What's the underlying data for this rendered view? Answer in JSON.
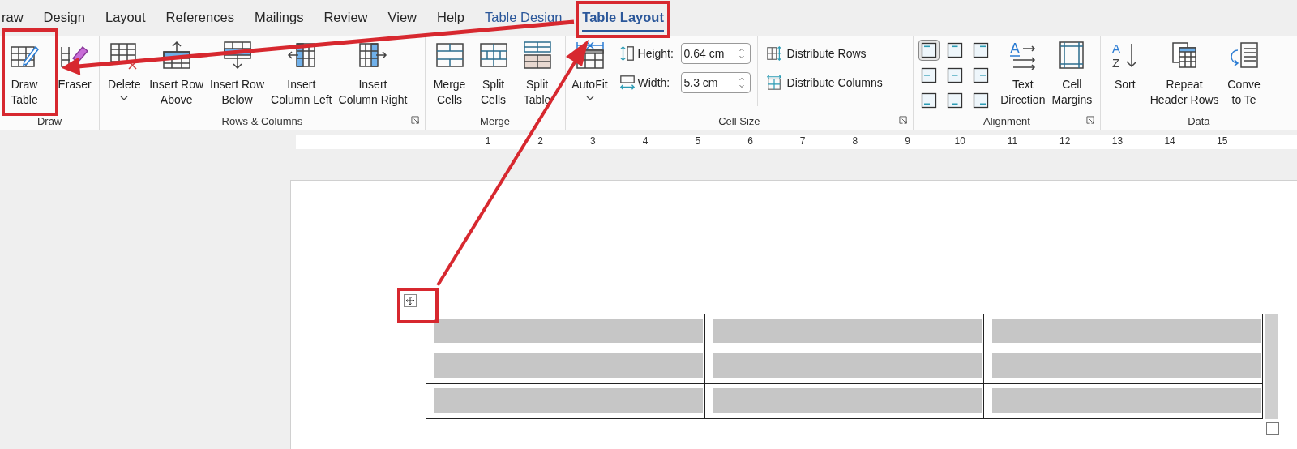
{
  "tabs": [
    {
      "label": "raw",
      "kind": "normal",
      "selected": false
    },
    {
      "label": "Design",
      "kind": "normal",
      "selected": false
    },
    {
      "label": "Layout",
      "kind": "normal",
      "selected": false
    },
    {
      "label": "References",
      "kind": "normal",
      "selected": false
    },
    {
      "label": "Mailings",
      "kind": "normal",
      "selected": false
    },
    {
      "label": "Review",
      "kind": "normal",
      "selected": false
    },
    {
      "label": "View",
      "kind": "normal",
      "selected": false
    },
    {
      "label": "Help",
      "kind": "normal",
      "selected": false
    },
    {
      "label": "Table Design",
      "kind": "contextual",
      "selected": false
    },
    {
      "label": "Table Layout",
      "kind": "contextual",
      "selected": true
    }
  ],
  "ribbon": {
    "groups": [
      {
        "label": "Draw",
        "launcher": false,
        "items": [
          {
            "kind": "large",
            "label": "Draw\nTable",
            "dropdown": false
          },
          {
            "kind": "large",
            "label": "Eraser",
            "dropdown": false
          }
        ]
      },
      {
        "label": "Rows & Columns",
        "launcher": true,
        "items": [
          {
            "kind": "large",
            "label": "Delete",
            "dropdown": true
          },
          {
            "kind": "large",
            "label": "Insert Row\nAbove",
            "dropdown": false
          },
          {
            "kind": "large",
            "label": "Insert Row\nBelow",
            "dropdown": false
          },
          {
            "kind": "large",
            "label": "Insert\nColumn Left",
            "dropdown": false
          },
          {
            "kind": "large",
            "label": "Insert\nColumn Right",
            "dropdown": false
          }
        ]
      },
      {
        "label": "Merge",
        "launcher": false,
        "items": [
          {
            "kind": "large",
            "label": "Merge\nCells",
            "dropdown": false
          },
          {
            "kind": "large",
            "label": "Split\nCells",
            "dropdown": false
          },
          {
            "kind": "large",
            "label": "Split\nTable",
            "dropdown": false
          }
        ]
      },
      {
        "label": "Cell Size",
        "launcher": true,
        "items": [
          {
            "kind": "large",
            "label": "AutoFit",
            "dropdown": true
          },
          {
            "kind": "stack",
            "items": [
              {
                "kind": "spin",
                "label": "Height:",
                "value": "0.64 cm"
              },
              {
                "kind": "spin",
                "label": "Width:",
                "value": "5.3 cm"
              }
            ]
          },
          {
            "kind": "stack",
            "items": [
              {
                "kind": "small",
                "label": "Distribute Rows"
              },
              {
                "kind": "small",
                "label": "Distribute Columns"
              }
            ]
          }
        ]
      },
      {
        "label": "Alignment",
        "launcher": true,
        "items": [
          {
            "kind": "align_grid",
            "cells": [
              {
                "selected": true
              },
              {
                "selected": false
              },
              {
                "selected": false
              },
              {
                "selected": false
              },
              {
                "selected": false
              },
              {
                "selected": false
              },
              {
                "selected": false
              },
              {
                "selected": false
              },
              {
                "selected": false
              }
            ]
          },
          {
            "kind": "large",
            "label": "Text\nDirection",
            "dropdown": false,
            "icon_text": [
              "A"
            ]
          },
          {
            "kind": "large",
            "label": "Cell\nMargins",
            "dropdown": false
          }
        ]
      },
      {
        "label": "Data",
        "launcher": false,
        "items": [
          {
            "kind": "large",
            "label": "Sort",
            "dropdown": false,
            "icon_text": [
              "A",
              "Z"
            ]
          },
          {
            "kind": "large",
            "label": "Repeat\nHeader Rows",
            "dropdown": false
          },
          {
            "kind": "large",
            "label": "Conve\nto Te",
            "dropdown": false
          }
        ]
      }
    ]
  },
  "ruler": {
    "labels": [
      "1",
      "2",
      "3",
      "4",
      "5",
      "6",
      "7",
      "8",
      "9",
      "10",
      "11",
      "12",
      "13",
      "14",
      "15"
    ]
  },
  "document": {
    "table": {
      "rows": [
        {
          "cells": [
            {
              "selected": true
            },
            {
              "selected": true
            },
            {
              "selected": true
            }
          ]
        },
        {
          "cells": [
            {
              "selected": true
            },
            {
              "selected": true
            },
            {
              "selected": true
            }
          ]
        },
        {
          "cells": [
            {
              "selected": true
            },
            {
              "selected": true
            },
            {
              "selected": true
            }
          ]
        }
      ]
    }
  }
}
